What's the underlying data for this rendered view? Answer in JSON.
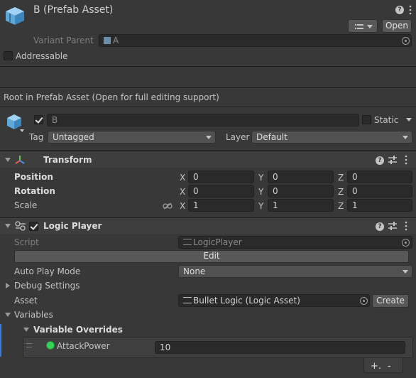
{
  "header": {
    "title": "B (Prefab Asset)",
    "open_label": "Open",
    "variant_parent_label": "Variant Parent",
    "variant_parent_value": "A",
    "addressable_label": "Addressable"
  },
  "notice": "Root in Prefab Asset (Open for full editing support)",
  "gameobject": {
    "name": "B",
    "static_label": "Static",
    "tag_label": "Tag",
    "tag_value": "Untagged",
    "layer_label": "Layer",
    "layer_value": "Default"
  },
  "transform": {
    "title": "Transform",
    "position_label": "Position",
    "rotation_label": "Rotation",
    "scale_label": "Scale",
    "axes": [
      "X",
      "Y",
      "Z"
    ],
    "position": [
      "0",
      "0",
      "0"
    ],
    "rotation": [
      "0",
      "0",
      "0"
    ],
    "scale": [
      "1",
      "1",
      "1"
    ]
  },
  "logic_player": {
    "title": "Logic Player",
    "script_label": "Script",
    "script_value": "LogicPlayer",
    "edit_label": "Edit",
    "auto_play_label": "Auto Play Mode",
    "auto_play_value": "None",
    "debug_settings_label": "Debug Settings",
    "asset_label": "Asset",
    "asset_value": "Bullet Logic (Logic Asset)",
    "create_label": "Create",
    "variables_label": "Variables",
    "variable_overrides_label": "Variable Overrides",
    "override_name": "AttackPower",
    "override_value": "10",
    "add_label": "+.",
    "remove_label": "-"
  },
  "icons": {
    "help": "help-icon",
    "presets": "presets-icon",
    "menu": "kebab-menu-icon",
    "prefab": "prefab-cube-icon",
    "transform": "transform-axes-icon",
    "script": "script-icon",
    "constrain": "constrain-proportions-icon"
  }
}
